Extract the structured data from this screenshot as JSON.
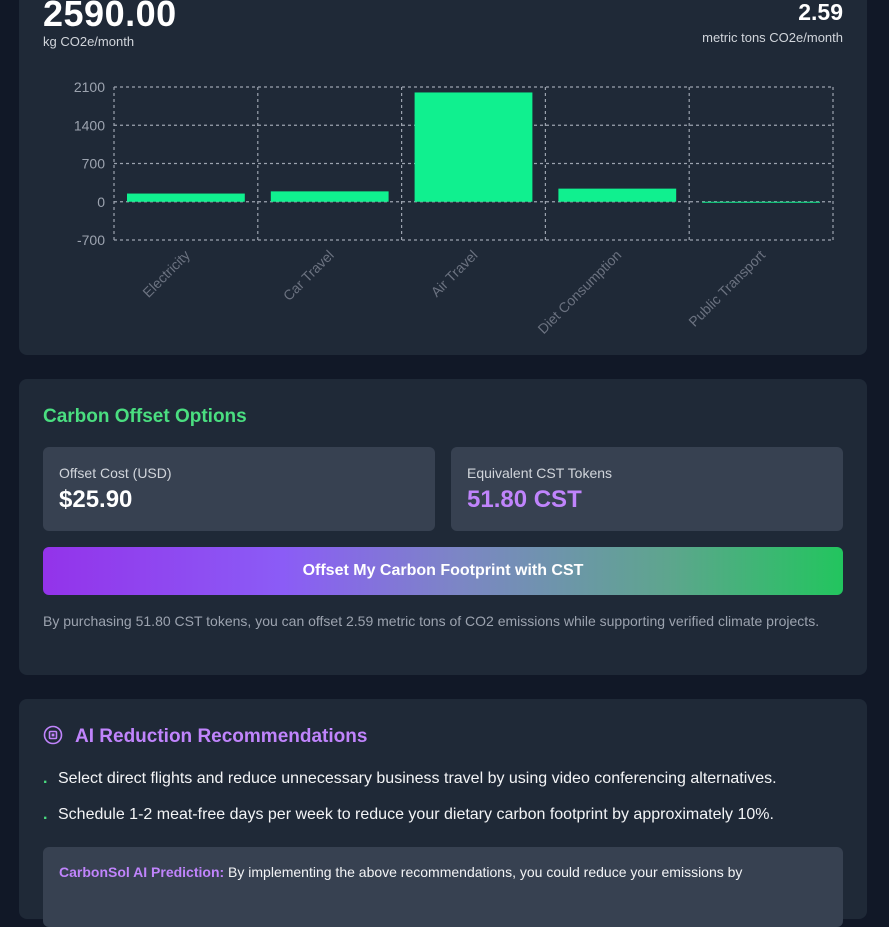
{
  "summary": {
    "monthly_kg": "2590.00",
    "monthly_kg_unit": "kg CO2e/month",
    "monthly_tons": "2.59",
    "monthly_tons_unit": "metric tons CO2e/month"
  },
  "chart_data": {
    "type": "bar",
    "categories": [
      "Electricity",
      "Car Travel",
      "Air Travel",
      "Diet Consumption",
      "Public Transport"
    ],
    "values": [
      150,
      190,
      2000,
      240,
      0
    ],
    "ylim": [
      -700,
      2100
    ],
    "yticks": [
      "2100",
      "1400",
      "700",
      "0",
      "-700"
    ],
    "ytick_values": [
      2100,
      1400,
      700,
      0,
      -700
    ],
    "grid": true,
    "bar_color": "#10f08f",
    "title": "",
    "xlabel": "",
    "ylabel": ""
  },
  "offset": {
    "title": "Carbon Offset Options",
    "cost_label": "Offset Cost (USD)",
    "cost_value": "$25.90",
    "tokens_label": "Equivalent CST Tokens",
    "tokens_value": "51.80 CST",
    "button_label": "Offset My Carbon Footprint with CST",
    "note": "By purchasing 51.80 CST tokens, you can offset 2.59 metric tons of CO2 emissions while supporting verified climate projects."
  },
  "ai": {
    "icon": "chip-icon",
    "title": "AI Reduction Recommendations",
    "recommendations": [
      "Select direct flights and reduce unnecessary business travel by using video conferencing alternatives.",
      "Schedule 1-2 meat-free days per week to reduce your dietary carbon footprint by approximately 10%."
    ],
    "prediction_label": "CarbonSol AI Prediction:",
    "prediction_text": "By implementing the above recommendations, you could reduce your emissions by"
  },
  "colors": {
    "background": "#111827",
    "card": "#1f2937",
    "accent_green": "#4ade80",
    "accent_purple": "#c084fc"
  }
}
